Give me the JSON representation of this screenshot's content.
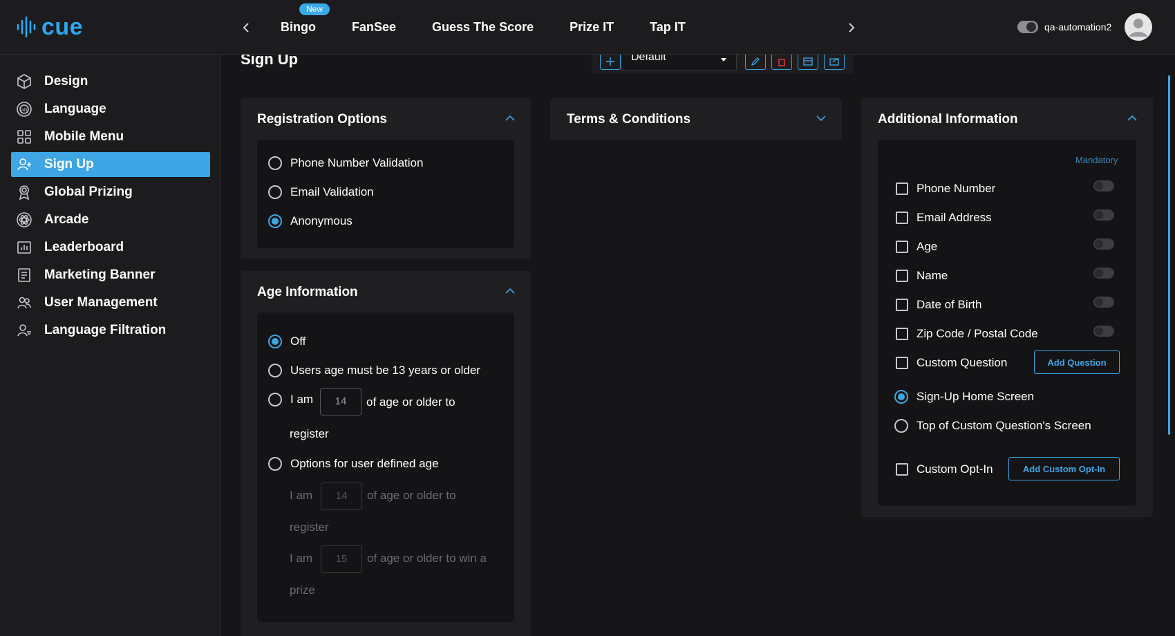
{
  "app": {
    "logo_text": "cue",
    "accent": "#3ea6e4"
  },
  "topnav": {
    "tabs": [
      {
        "label": "Bingo",
        "badge": "New"
      },
      {
        "label": "FanSee"
      },
      {
        "label": "Guess The Score"
      },
      {
        "label": "Prize IT"
      },
      {
        "label": "Tap IT"
      }
    ],
    "username": "qa-automation2"
  },
  "sidebar": {
    "items": [
      {
        "label": "Design",
        "icon": "cube-icon"
      },
      {
        "label": "Language",
        "icon": "language-icon"
      },
      {
        "label": "Mobile Menu",
        "icon": "grid-icon"
      },
      {
        "label": "Sign Up",
        "icon": "user-add-icon",
        "active": true
      },
      {
        "label": "Global Prizing",
        "icon": "award-icon"
      },
      {
        "label": "Arcade",
        "icon": "atom-icon"
      },
      {
        "label": "Leaderboard",
        "icon": "leaderboard-icon"
      },
      {
        "label": "Marketing Banner",
        "icon": "banner-icon"
      },
      {
        "label": "User Management",
        "icon": "users-icon"
      },
      {
        "label": "Language Filtration",
        "icon": "user-filter-icon"
      }
    ]
  },
  "page": {
    "title": "Sign Up",
    "template_select": "Default"
  },
  "registration": {
    "title": "Registration Options",
    "options": [
      "Phone Number Validation",
      "Email Validation",
      "Anonymous"
    ],
    "selected": "Anonymous"
  },
  "terms": {
    "title": "Terms & Conditions"
  },
  "age": {
    "title": "Age Information",
    "off": "Off",
    "min13": "Users age must be 13 years or older",
    "i_am": "I am",
    "age_value": "14",
    "older_to": "of age or older to",
    "register": "register",
    "user_defined": "Options for user defined age",
    "ud_register_age": "14",
    "ud_prize_age": "15",
    "older_to_win": "of age or older to win a",
    "prize": "prize",
    "selected": "Off"
  },
  "additional": {
    "title": "Additional Information",
    "mandatory": "Mandatory",
    "fields": [
      "Phone Number",
      "Email Address",
      "Age",
      "Name",
      "Date of Birth",
      "Zip Code / Postal Code"
    ],
    "custom_question": "Custom Question",
    "add_question": "Add Question",
    "placement": [
      "Sign-Up Home Screen",
      "Top of Custom Question's Screen"
    ],
    "placement_selected": "Sign-Up Home Screen",
    "custom_optin": "Custom Opt-In",
    "add_custom_optin": "Add Custom Opt-In"
  }
}
